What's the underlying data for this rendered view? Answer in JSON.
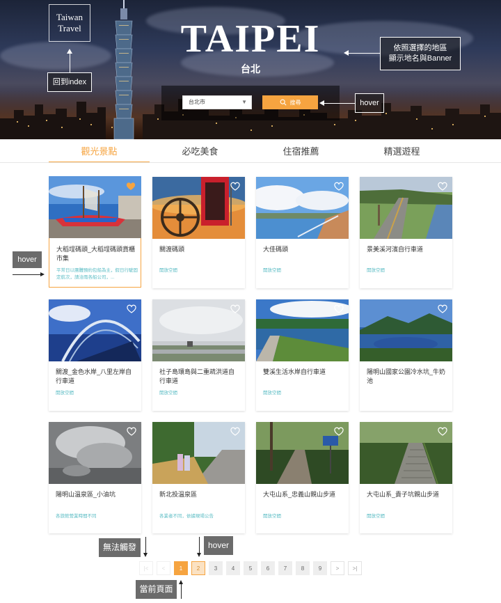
{
  "banner": {
    "logo_line1": "Taiwan",
    "logo_line2": "Travel",
    "city_title": "TAIPEI",
    "city_subtitle": "台北",
    "select_value": "台北市",
    "search_label": "搜尋"
  },
  "annotations": {
    "back_to_index": "回到index",
    "banner_note_line1": "依照選擇的地區",
    "banner_note_line2": "顯示地名與Banner",
    "search_hover": "hover",
    "card_hover": "hover",
    "disabled_note": "無法觸發",
    "page_hover": "hover",
    "current_page_note": "當前頁面"
  },
  "tabs": [
    "觀光景點",
    "必吃美食",
    "住宿推薦",
    "精選遊程"
  ],
  "active_tab": 0,
  "cards": [
    {
      "name": "大稻埕碼頭_大稻埕碼頭貨櫃市集",
      "desc": "平常日以團體預約包船為主，假日行駛固定航次，請洽雨各船公司，...",
      "favorited": true,
      "scene": "ship"
    },
    {
      "name": "關渡碼頭",
      "desc": "開放空間",
      "favorited": false,
      "scene": "wheel"
    },
    {
      "name": "大佳碼頭",
      "desc": "開放空間",
      "favorited": false,
      "scene": "river"
    },
    {
      "name": "景美溪河濱自行車道",
      "desc": "開放空間",
      "favorited": false,
      "scene": "bikeway"
    },
    {
      "name": "關渡_金色水岸_八里左岸自行車道",
      "desc": "開放空間",
      "favorited": false,
      "scene": "bridge"
    },
    {
      "name": "社子島環島與二重疏洪道自行車道",
      "desc": "開放空間",
      "favorited": false,
      "scene": "flood"
    },
    {
      "name": "雙溪生活水岸自行車道",
      "desc": "開放空間",
      "favorited": false,
      "scene": "lake"
    },
    {
      "name": "陽明山國家公園冷水坑_牛奶池",
      "desc": "",
      "favorited": false,
      "scene": "pond"
    },
    {
      "name": "陽明山溫泉區_小油坑",
      "desc": "各旅館營業時間不同",
      "favorited": false,
      "scene": "fumarole"
    },
    {
      "name": "新北投溫泉區",
      "desc": "各業者不同，依據現場公告",
      "favorited": false,
      "scene": "street"
    },
    {
      "name": "大屯山系_忠義山親山步道",
      "desc": "開放空間",
      "favorited": false,
      "scene": "trail"
    },
    {
      "name": "大屯山系_貴子坑親山步道",
      "desc": "開放空間",
      "favorited": false,
      "scene": "stairs"
    }
  ],
  "pagination": {
    "first_icon": "first-page-icon",
    "prev_icon": "prev-page-icon",
    "pages": [
      "1",
      "2",
      "3",
      "4",
      "5",
      "6",
      "7",
      "8",
      "9"
    ],
    "current": "1",
    "hovered": "2",
    "next_label": ">",
    "last_label": ">|"
  },
  "colors": {
    "accent": "#f6a440",
    "desc_text": "#5bbcc4",
    "note_bg": "#5a5a5a"
  }
}
